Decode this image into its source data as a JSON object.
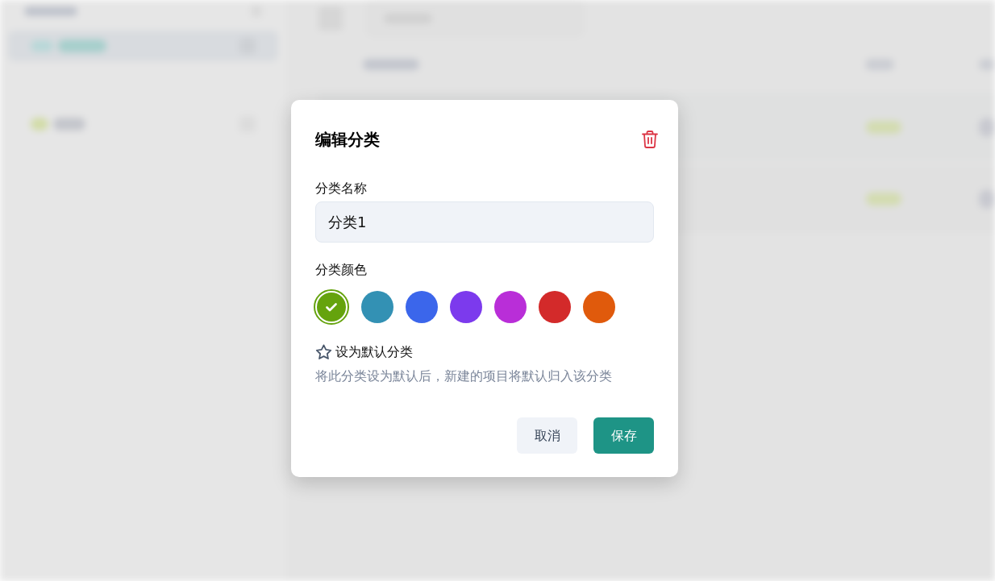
{
  "dialog": {
    "title": "编辑分类",
    "name_field": {
      "label": "分类名称",
      "value": "分类1"
    },
    "color_field": {
      "label": "分类颜色",
      "colors": [
        {
          "color": "#65a30d",
          "selected": true
        },
        {
          "color": "#3391b4",
          "selected": false
        },
        {
          "color": "#3b66eb",
          "selected": false
        },
        {
          "color": "#7c3aed",
          "selected": false
        },
        {
          "color": "#b92ed8",
          "selected": false
        },
        {
          "color": "#d32a2a",
          "selected": false
        },
        {
          "color": "#e05a0c",
          "selected": false
        }
      ]
    },
    "default_option": {
      "label": "设为默认分类",
      "checked": false,
      "description": "将此分类设为默认后，新建的项目将默认归入该分类"
    },
    "buttons": [
      {
        "label": "取消",
        "kind": "secondary"
      },
      {
        "label": "保存",
        "kind": "primary"
      }
    ]
  }
}
